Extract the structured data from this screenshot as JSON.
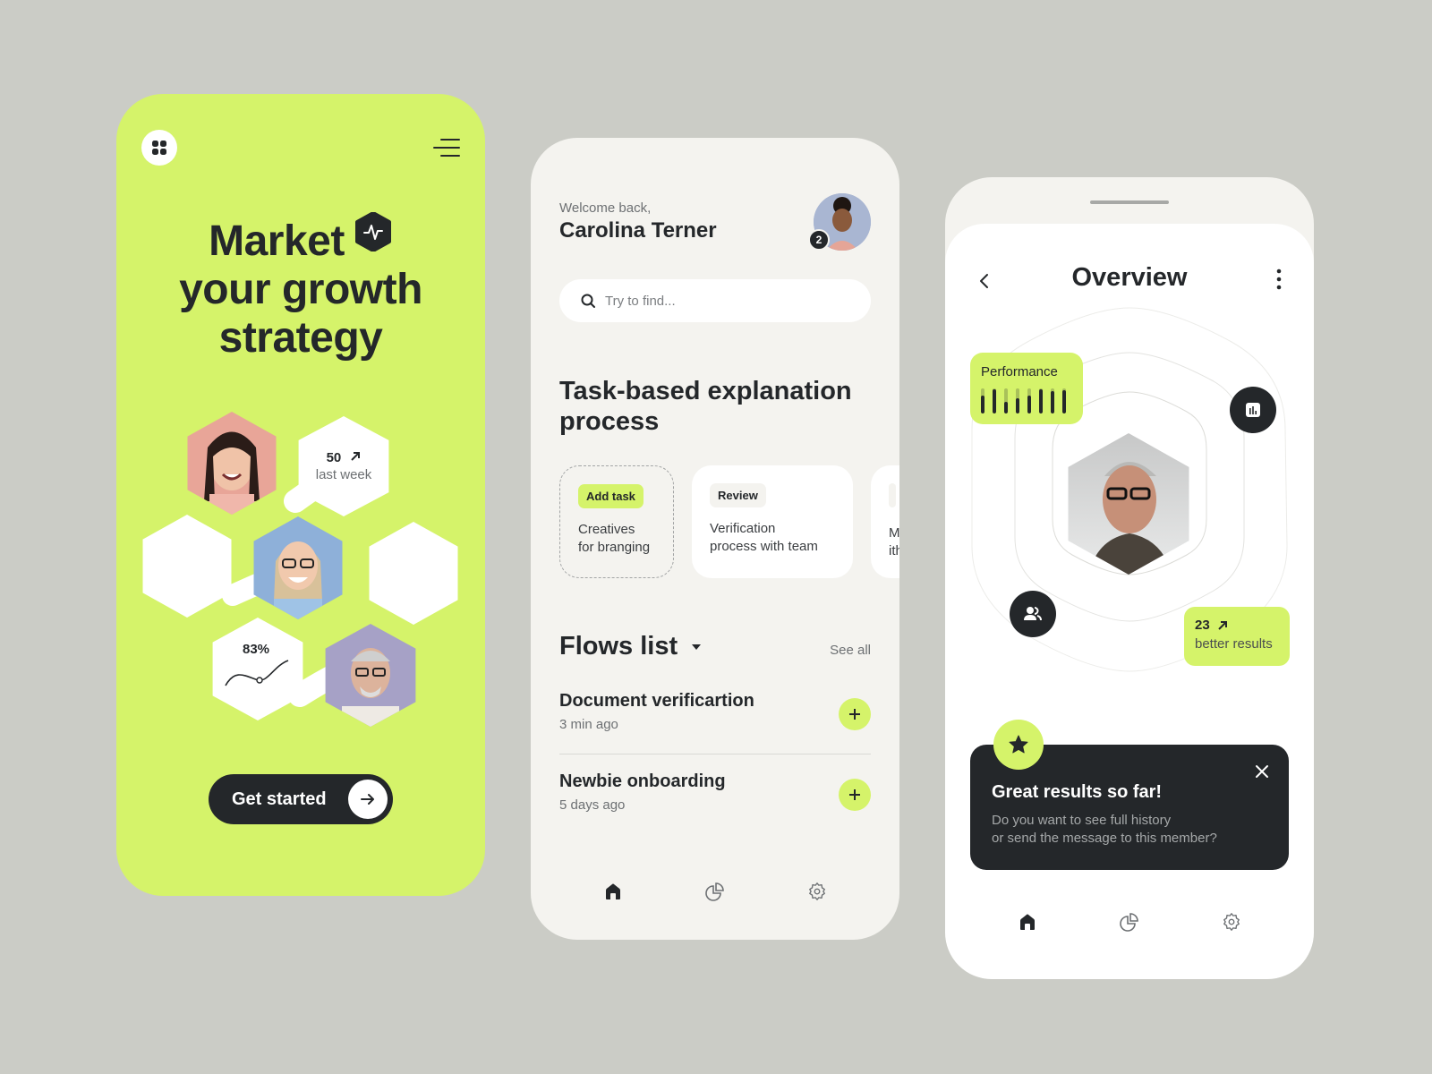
{
  "colors": {
    "accent": "#d5f36a",
    "dark": "#24272a",
    "background": "#cbccc6",
    "surface": "#f4f3ef"
  },
  "phone1": {
    "grid_icon": "grid-icon",
    "menu_icon": "menu-icon",
    "title_line1": "Market",
    "title_line2": "your growth",
    "title_line3": "strategy",
    "title_icon": "pulse-icon",
    "stat_weekly": {
      "value": "50",
      "label": "last week",
      "icon": "arrow-up-right-icon"
    },
    "stat_percent": {
      "value": "83%"
    },
    "cta_label": "Get started",
    "cta_icon": "arrow-right-icon"
  },
  "phone2": {
    "welcome": "Welcome back,",
    "user_name": "Carolina Terner",
    "notification_count": "2",
    "search": {
      "placeholder": "Try to find...",
      "value": ""
    },
    "section_title": "Task-based explanation process",
    "tasks": [
      {
        "chip": "Add task",
        "text_line1": "Creatives",
        "text_line2": "for branging"
      },
      {
        "chip": "Review",
        "text_line1": "Verification",
        "text_line2": "process with team"
      },
      {
        "chip": "",
        "text_line1": "M",
        "text_line2": "ith"
      }
    ],
    "flows_title": "Flows list",
    "see_all": "See all",
    "flows": [
      {
        "title": "Document verificartion",
        "time": "3 min ago"
      },
      {
        "title": "Newbie onboarding",
        "time": "5 days ago"
      }
    ],
    "tabs": [
      "home",
      "analytics",
      "settings"
    ]
  },
  "phone3": {
    "title": "Overview",
    "performance": {
      "label": "Performance",
      "levels": [
        0.72,
        0.95,
        0.45,
        0.62,
        0.72,
        0.95,
        0.88,
        0.92
      ]
    },
    "result": {
      "value": "23",
      "label": "better results"
    },
    "toast": {
      "title": "Great results so far!",
      "body_line1": "Do you want to see full history",
      "body_line2": "or send the message to this member?"
    },
    "tabs": [
      "home",
      "analytics",
      "settings"
    ]
  }
}
